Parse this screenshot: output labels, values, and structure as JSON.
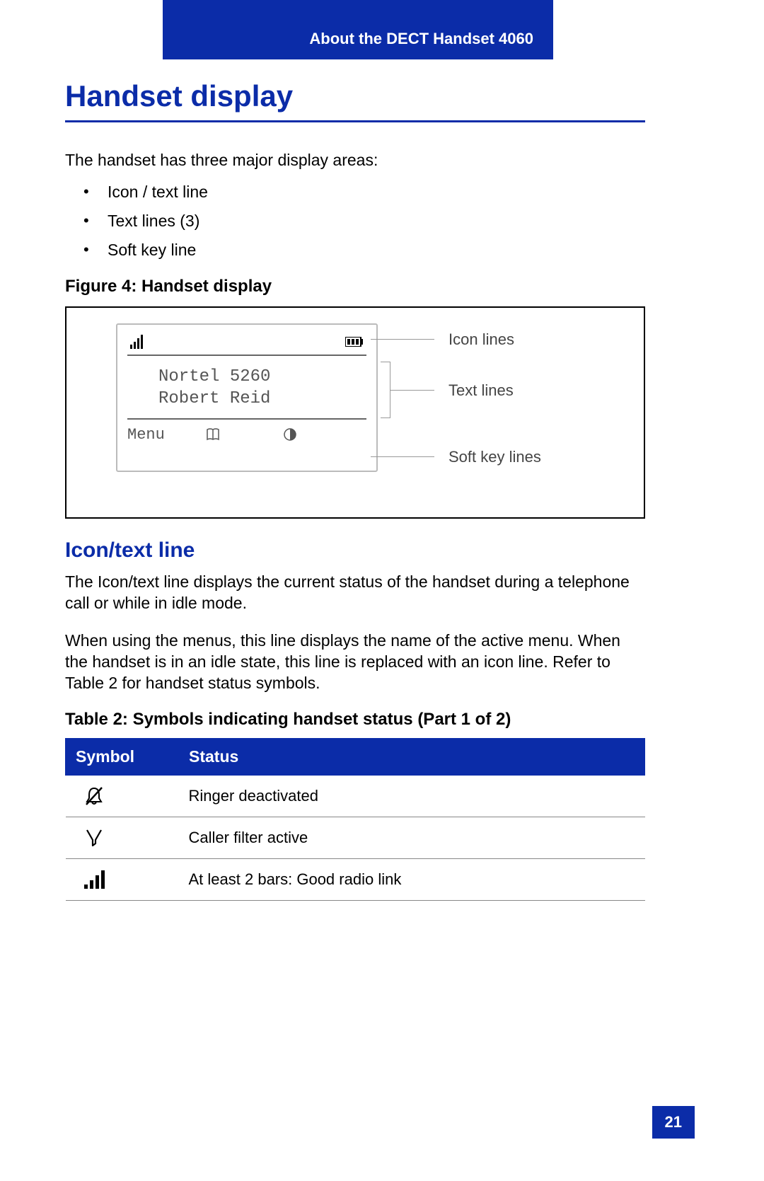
{
  "header": {
    "chapter": "About the DECT Handset 4060"
  },
  "title": "Handset display",
  "intro": "The handset has three major display areas:",
  "bullets": [
    "Icon / text line",
    "Text lines (3)",
    "Soft key line"
  ],
  "figure": {
    "caption": "Figure 4: Handset display",
    "lcd_line1": "Nortel 5260",
    "lcd_line2": "Robert Reid",
    "lcd_menu": "Menu",
    "label_icon": "Icon lines",
    "label_text": "Text lines",
    "label_soft": "Soft key lines"
  },
  "section": {
    "heading": "Icon/text line",
    "p1": "The Icon/text line displays the current status of the handset during a telephone call or while in idle mode.",
    "p2": "When using the menus, this line displays the name of the active menu. When the handset is in an idle state, this line is replaced with an icon line. Refer to Table 2 for handset status symbols."
  },
  "table": {
    "caption": "Table 2: Symbols indicating handset status (Part 1 of 2)",
    "col1": "Symbol",
    "col2": "Status",
    "rows": [
      {
        "symbol": "bell-slash-icon",
        "status": "Ringer deactivated"
      },
      {
        "symbol": "filter-icon",
        "status": "Caller filter active"
      },
      {
        "symbol": "signal-bars-icon",
        "status": "At least 2 bars: Good radio link"
      }
    ]
  },
  "page_number": "21"
}
